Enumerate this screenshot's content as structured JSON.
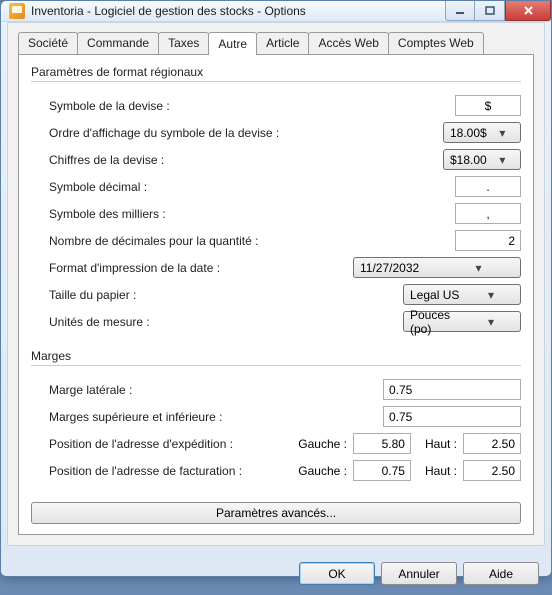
{
  "window": {
    "title": "Inventoria - Logiciel de gestion des stocks - Options"
  },
  "tabs": {
    "societe": "Société",
    "commande": "Commande",
    "taxes": "Taxes",
    "autre": "Autre",
    "article": "Article",
    "acces_web": "Accès Web",
    "comptes_web": "Comptes Web"
  },
  "regional": {
    "legend": "Paramètres de format régionaux",
    "currency_symbol_label": "Symbole de la devise :",
    "currency_symbol_value": "$",
    "currency_order_label": "Ordre d'affichage du symbole de la devise :",
    "currency_order_value": "18.00$",
    "currency_digits_label": "Chiffres de la devise :",
    "currency_digits_value": "$18.00",
    "decimal_symbol_label": "Symbole décimal :",
    "decimal_symbol_value": ".",
    "thousand_symbol_label": "Symbole des milliers :",
    "thousand_symbol_value": ",",
    "qty_decimals_label": "Nombre de décimales pour la quantité :",
    "qty_decimals_value": "2",
    "date_format_label": "Format d'impression de la date :",
    "date_format_value": "11/27/2032",
    "paper_size_label": "Taille du papier :",
    "paper_size_value": "Legal US",
    "units_label": "Unités de mesure :",
    "units_value": "Pouces (po)"
  },
  "margins": {
    "legend": "Marges",
    "side_label": "Marge latérale :",
    "side_value": "0.75",
    "topbot_label": "Marges supérieure et inférieure :",
    "topbot_value": "0.75",
    "ship_addr_label": "Position de l'adresse d'expédition :",
    "bill_addr_label": "Position de l'adresse de facturation :",
    "left_word": "Gauche :",
    "top_word": "Haut :",
    "ship_left": "5.80",
    "ship_top": "2.50",
    "bill_left": "0.75",
    "bill_top": "2.50"
  },
  "advanced_button": "Paramètres avancés...",
  "buttons": {
    "ok": "OK",
    "cancel": "Annuler",
    "help": "Aide"
  }
}
